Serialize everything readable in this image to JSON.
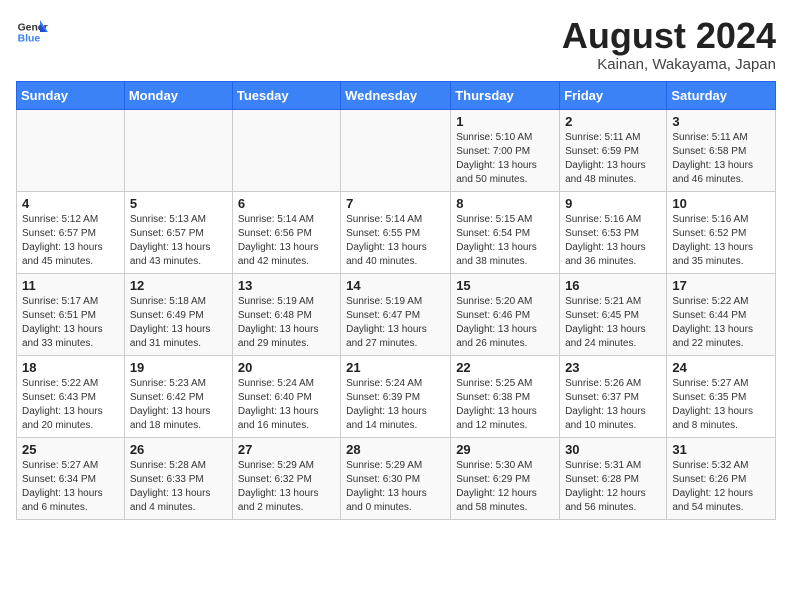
{
  "logo": {
    "line1": "General",
    "line2": "Blue"
  },
  "title": "August 2024",
  "subtitle": "Kainan, Wakayama, Japan",
  "days_of_week": [
    "Sunday",
    "Monday",
    "Tuesday",
    "Wednesday",
    "Thursday",
    "Friday",
    "Saturday"
  ],
  "weeks": [
    [
      {
        "day": "",
        "info": ""
      },
      {
        "day": "",
        "info": ""
      },
      {
        "day": "",
        "info": ""
      },
      {
        "day": "",
        "info": ""
      },
      {
        "day": "1",
        "info": "Sunrise: 5:10 AM\nSunset: 7:00 PM\nDaylight: 13 hours\nand 50 minutes."
      },
      {
        "day": "2",
        "info": "Sunrise: 5:11 AM\nSunset: 6:59 PM\nDaylight: 13 hours\nand 48 minutes."
      },
      {
        "day": "3",
        "info": "Sunrise: 5:11 AM\nSunset: 6:58 PM\nDaylight: 13 hours\nand 46 minutes."
      }
    ],
    [
      {
        "day": "4",
        "info": "Sunrise: 5:12 AM\nSunset: 6:57 PM\nDaylight: 13 hours\nand 45 minutes."
      },
      {
        "day": "5",
        "info": "Sunrise: 5:13 AM\nSunset: 6:57 PM\nDaylight: 13 hours\nand 43 minutes."
      },
      {
        "day": "6",
        "info": "Sunrise: 5:14 AM\nSunset: 6:56 PM\nDaylight: 13 hours\nand 42 minutes."
      },
      {
        "day": "7",
        "info": "Sunrise: 5:14 AM\nSunset: 6:55 PM\nDaylight: 13 hours\nand 40 minutes."
      },
      {
        "day": "8",
        "info": "Sunrise: 5:15 AM\nSunset: 6:54 PM\nDaylight: 13 hours\nand 38 minutes."
      },
      {
        "day": "9",
        "info": "Sunrise: 5:16 AM\nSunset: 6:53 PM\nDaylight: 13 hours\nand 36 minutes."
      },
      {
        "day": "10",
        "info": "Sunrise: 5:16 AM\nSunset: 6:52 PM\nDaylight: 13 hours\nand 35 minutes."
      }
    ],
    [
      {
        "day": "11",
        "info": "Sunrise: 5:17 AM\nSunset: 6:51 PM\nDaylight: 13 hours\nand 33 minutes."
      },
      {
        "day": "12",
        "info": "Sunrise: 5:18 AM\nSunset: 6:49 PM\nDaylight: 13 hours\nand 31 minutes."
      },
      {
        "day": "13",
        "info": "Sunrise: 5:19 AM\nSunset: 6:48 PM\nDaylight: 13 hours\nand 29 minutes."
      },
      {
        "day": "14",
        "info": "Sunrise: 5:19 AM\nSunset: 6:47 PM\nDaylight: 13 hours\nand 27 minutes."
      },
      {
        "day": "15",
        "info": "Sunrise: 5:20 AM\nSunset: 6:46 PM\nDaylight: 13 hours\nand 26 minutes."
      },
      {
        "day": "16",
        "info": "Sunrise: 5:21 AM\nSunset: 6:45 PM\nDaylight: 13 hours\nand 24 minutes."
      },
      {
        "day": "17",
        "info": "Sunrise: 5:22 AM\nSunset: 6:44 PM\nDaylight: 13 hours\nand 22 minutes."
      }
    ],
    [
      {
        "day": "18",
        "info": "Sunrise: 5:22 AM\nSunset: 6:43 PM\nDaylight: 13 hours\nand 20 minutes."
      },
      {
        "day": "19",
        "info": "Sunrise: 5:23 AM\nSunset: 6:42 PM\nDaylight: 13 hours\nand 18 minutes."
      },
      {
        "day": "20",
        "info": "Sunrise: 5:24 AM\nSunset: 6:40 PM\nDaylight: 13 hours\nand 16 minutes."
      },
      {
        "day": "21",
        "info": "Sunrise: 5:24 AM\nSunset: 6:39 PM\nDaylight: 13 hours\nand 14 minutes."
      },
      {
        "day": "22",
        "info": "Sunrise: 5:25 AM\nSunset: 6:38 PM\nDaylight: 13 hours\nand 12 minutes."
      },
      {
        "day": "23",
        "info": "Sunrise: 5:26 AM\nSunset: 6:37 PM\nDaylight: 13 hours\nand 10 minutes."
      },
      {
        "day": "24",
        "info": "Sunrise: 5:27 AM\nSunset: 6:35 PM\nDaylight: 13 hours\nand 8 minutes."
      }
    ],
    [
      {
        "day": "25",
        "info": "Sunrise: 5:27 AM\nSunset: 6:34 PM\nDaylight: 13 hours\nand 6 minutes."
      },
      {
        "day": "26",
        "info": "Sunrise: 5:28 AM\nSunset: 6:33 PM\nDaylight: 13 hours\nand 4 minutes."
      },
      {
        "day": "27",
        "info": "Sunrise: 5:29 AM\nSunset: 6:32 PM\nDaylight: 13 hours\nand 2 minutes."
      },
      {
        "day": "28",
        "info": "Sunrise: 5:29 AM\nSunset: 6:30 PM\nDaylight: 13 hours\nand 0 minutes."
      },
      {
        "day": "29",
        "info": "Sunrise: 5:30 AM\nSunset: 6:29 PM\nDaylight: 12 hours\nand 58 minutes."
      },
      {
        "day": "30",
        "info": "Sunrise: 5:31 AM\nSunset: 6:28 PM\nDaylight: 12 hours\nand 56 minutes."
      },
      {
        "day": "31",
        "info": "Sunrise: 5:32 AM\nSunset: 6:26 PM\nDaylight: 12 hours\nand 54 minutes."
      }
    ]
  ]
}
